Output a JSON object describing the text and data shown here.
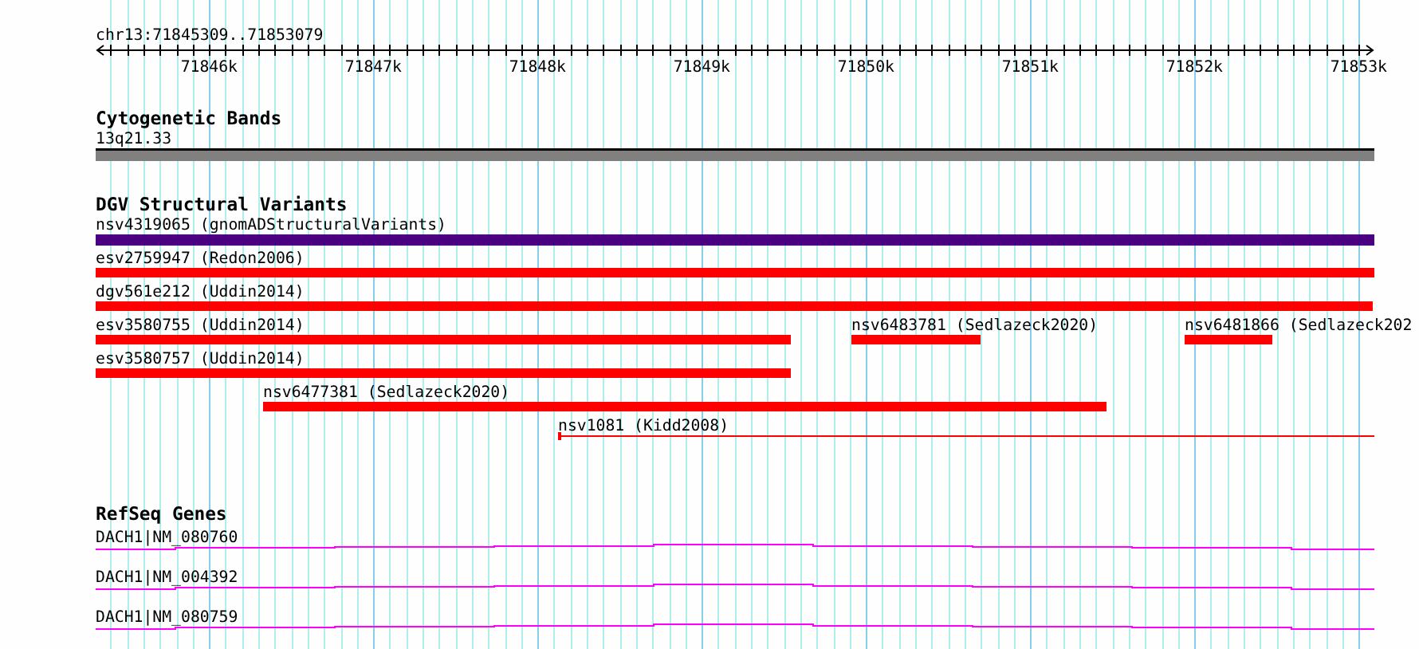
{
  "ruler": {
    "range": "chr13:71845309..71853079",
    "ticks": [
      "71846k",
      "71847k",
      "71848k",
      "71849k",
      "71850k",
      "71851k",
      "71852k",
      "71853k"
    ]
  },
  "tracks": [
    {
      "kind": "cytoband",
      "title": "Cytogenetic Bands",
      "features": [
        {
          "label": "13q21.33"
        }
      ]
    },
    {
      "kind": "variants",
      "title": "DGV Structural Variants",
      "features": [
        {
          "label": "nsv4319065 (gnomADStructuralVariants)",
          "kind": "bar",
          "color": "#4b0082"
        },
        {
          "label": "esv2759947 (Redon2006)",
          "kind": "bar",
          "color": "#ff0000"
        },
        {
          "label": "dgv561e212 (Uddin2014)",
          "kind": "bar",
          "color": "#ff0000"
        },
        {
          "label": "esv3580755 (Uddin2014)",
          "kind": "bar",
          "color": "#ff0000"
        },
        {
          "label": "nsv6483781 (Sedlazeck2020)",
          "kind": "bar",
          "color": "#ff0000"
        },
        {
          "label": "nsv6481866 (Sedlazeck202",
          "kind": "bar",
          "color": "#ff0000"
        },
        {
          "label": "esv3580757 (Uddin2014)",
          "kind": "bar",
          "color": "#ff0000"
        },
        {
          "label": "nsv6477381 (Sedlazeck2020)",
          "kind": "bar",
          "color": "#ff0000"
        },
        {
          "label": "nsv1081 (Kidd2008)",
          "kind": "line",
          "color": "#ff0000"
        }
      ]
    },
    {
      "kind": "genes",
      "title": "RefSeq Genes",
      "features": [
        {
          "label": "DACH1|NM_080760"
        },
        {
          "label": "DACH1|NM_004392"
        },
        {
          "label": "DACH1|NM_080759"
        }
      ]
    }
  ]
}
